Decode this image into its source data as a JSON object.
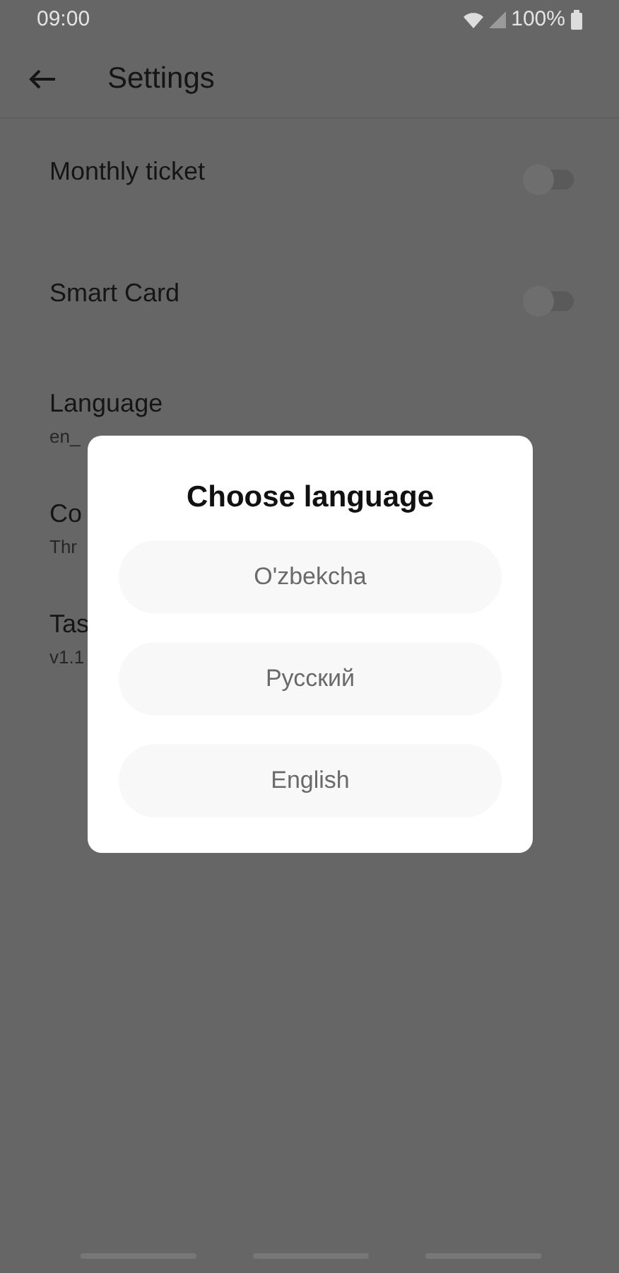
{
  "status_bar": {
    "time": "09:00",
    "battery": "100%"
  },
  "app_bar": {
    "title": "Settings"
  },
  "settings": [
    {
      "kind": "toggle",
      "title": "Monthly ticket",
      "on": false
    },
    {
      "kind": "toggle",
      "title": "Smart Card",
      "on": false
    },
    {
      "kind": "text",
      "title": "Language",
      "subtitle": "en_"
    },
    {
      "kind": "text",
      "title": "Co",
      "subtitle": "Thr"
    },
    {
      "kind": "text",
      "title": "Tas",
      "subtitle": "v1.1"
    }
  ],
  "dialog": {
    "title": "Choose language",
    "options": [
      "O'zbekcha",
      "Русский",
      "English"
    ]
  }
}
